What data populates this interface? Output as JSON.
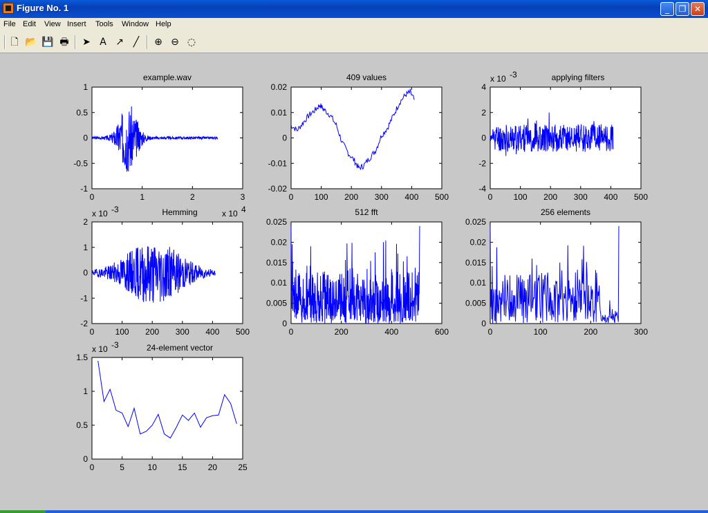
{
  "window": {
    "title": "Figure No. 1"
  },
  "menu": [
    "File",
    "Edit",
    "View",
    "Insert",
    "Tools",
    "Window",
    "Help"
  ],
  "toolbar": [
    {
      "name": "new-file-icon",
      "glyph": "🗋"
    },
    {
      "name": "open-folder-icon",
      "glyph": "📂"
    },
    {
      "name": "save-icon",
      "glyph": "💾"
    },
    {
      "name": "print-icon",
      "glyph": "🖶"
    },
    {
      "name": "select-arrow-icon",
      "glyph": "➤"
    },
    {
      "name": "insert-text-icon",
      "glyph": "A"
    },
    {
      "name": "insert-arrow-icon",
      "glyph": "↗"
    },
    {
      "name": "insert-line-icon",
      "glyph": "╱"
    },
    {
      "name": "zoom-in-icon",
      "glyph": "⊕"
    },
    {
      "name": "zoom-out-icon",
      "glyph": "⊖"
    },
    {
      "name": "rotate-3d-icon",
      "glyph": "◌"
    }
  ],
  "colors": {
    "line": "#0000ff",
    "axes_bg": "#ffffff",
    "figure_bg": "#c8c8c8"
  },
  "chart_data": [
    {
      "type": "line",
      "title": "example.wav",
      "xlim": [
        0,
        3
      ],
      "ylim": [
        -1,
        1
      ],
      "xticks": [
        "0",
        "1",
        "2",
        "3"
      ],
      "yticks": [
        "-1",
        "-0.5",
        "0",
        "0.5",
        "1"
      ],
      "exponent": "",
      "signal": {
        "kind": "burst",
        "x_start": 0,
        "x_end": 2.5,
        "center": 0.72,
        "width": 0.22,
        "amp": 0.65,
        "n": 500,
        "seed": 3
      }
    },
    {
      "type": "line",
      "title": "409 values",
      "xlim": [
        0,
        500
      ],
      "ylim": [
        -0.02,
        0.02
      ],
      "xticks": [
        "0",
        "100",
        "200",
        "300",
        "400",
        "500"
      ],
      "yticks": [
        "-0.02",
        "-0.01",
        "0",
        "0.01",
        "0.02"
      ],
      "exponent": "",
      "points": [
        [
          0,
          0.005
        ],
        [
          20,
          0.003
        ],
        [
          40,
          0.006
        ],
        [
          60,
          0.009
        ],
        [
          80,
          0.011
        ],
        [
          95,
          0.013
        ],
        [
          110,
          0.011
        ],
        [
          130,
          0.009
        ],
        [
          150,
          0.005
        ],
        [
          170,
          -0.002
        ],
        [
          190,
          -0.006
        ],
        [
          210,
          -0.009
        ],
        [
          225,
          -0.012
        ],
        [
          240,
          -0.011
        ],
        [
          260,
          -0.008
        ],
        [
          280,
          -0.005
        ],
        [
          300,
          0.001
        ],
        [
          320,
          0.004
        ],
        [
          340,
          0.009
        ],
        [
          360,
          0.014
        ],
        [
          380,
          0.017
        ],
        [
          395,
          0.018
        ],
        [
          409,
          0.015
        ]
      ],
      "noise": 0.0012,
      "seed": 7
    },
    {
      "type": "line",
      "title": "applying filters",
      "xlim": [
        0,
        500
      ],
      "ylim": [
        -4,
        4
      ],
      "xticks": [
        "0",
        "100",
        "200",
        "300",
        "400",
        "500"
      ],
      "yticks": [
        "-4",
        "-2",
        "0",
        "2",
        "4"
      ],
      "exponent": "x 10",
      "exponent_power": "-3",
      "signal": {
        "kind": "noise",
        "x_start": 0,
        "x_end": 409,
        "amp": 1.1,
        "n": 409,
        "seed": 11
      }
    },
    {
      "type": "line",
      "title": "Hemming",
      "xlim": [
        0,
        500
      ],
      "ylim": [
        -2,
        2
      ],
      "xticks": [
        "0",
        "100",
        "200",
        "300",
        "400",
        "500"
      ],
      "yticks": [
        "-2",
        "-1",
        "0",
        "1",
        "2"
      ],
      "exponent": "x 10",
      "exponent_power": "-3",
      "xexponent": "x 10",
      "xexponent_power": "4",
      "signal": {
        "kind": "burst",
        "x_start": 0,
        "x_end": 409,
        "center": 205,
        "width": 120,
        "amp": 1.2,
        "n": 409,
        "seed": 19
      }
    },
    {
      "type": "line",
      "title": "512 fft",
      "xlim": [
        0,
        600
      ],
      "ylim": [
        0,
        0.025
      ],
      "xticks": [
        "0",
        "200",
        "400",
        "600"
      ],
      "yticks": [
        "0",
        "0.005",
        "0.01",
        "0.015",
        "0.02",
        "0.025"
      ],
      "exponent": "",
      "signal": {
        "kind": "spectrum",
        "x_start": 0,
        "x_end": 512,
        "amp": 0.011,
        "n": 512,
        "seed": 23,
        "peak": 0.024
      }
    },
    {
      "type": "line",
      "title": "256 elements",
      "xlim": [
        0,
        300
      ],
      "ylim": [
        0,
        0.025
      ],
      "xticks": [
        "0",
        "100",
        "200",
        "300"
      ],
      "yticks": [
        "0",
        "0.005",
        "0.01",
        "0.015",
        "0.02",
        "0.025"
      ],
      "exponent": "",
      "signal": {
        "kind": "spectrum",
        "x_start": 0,
        "x_end": 256,
        "amp": 0.011,
        "n": 256,
        "seed": 29,
        "peak": 0.024,
        "taper": true
      }
    },
    {
      "type": "line",
      "title": "24-element vector",
      "xlim": [
        0,
        25
      ],
      "ylim": [
        0,
        1.5
      ],
      "xticks": [
        "0",
        "5",
        "10",
        "15",
        "20",
        "25"
      ],
      "yticks": [
        "0",
        "0.5",
        "1",
        "1.5"
      ],
      "exponent": "x 10",
      "exponent_power": "-3",
      "points": [
        [
          1,
          1.45
        ],
        [
          2,
          0.85
        ],
        [
          3,
          1.03
        ],
        [
          4,
          0.72
        ],
        [
          5,
          0.68
        ],
        [
          6,
          0.48
        ],
        [
          7,
          0.75
        ],
        [
          8,
          0.37
        ],
        [
          9,
          0.41
        ],
        [
          10,
          0.5
        ],
        [
          11,
          0.66
        ],
        [
          12,
          0.37
        ],
        [
          13,
          0.31
        ],
        [
          14,
          0.47
        ],
        [
          15,
          0.65
        ],
        [
          16,
          0.57
        ],
        [
          17,
          0.68
        ],
        [
          18,
          0.47
        ],
        [
          19,
          0.61
        ],
        [
          20,
          0.64
        ],
        [
          21,
          0.65
        ],
        [
          22,
          0.95
        ],
        [
          23,
          0.82
        ],
        [
          24,
          0.52
        ]
      ]
    }
  ]
}
